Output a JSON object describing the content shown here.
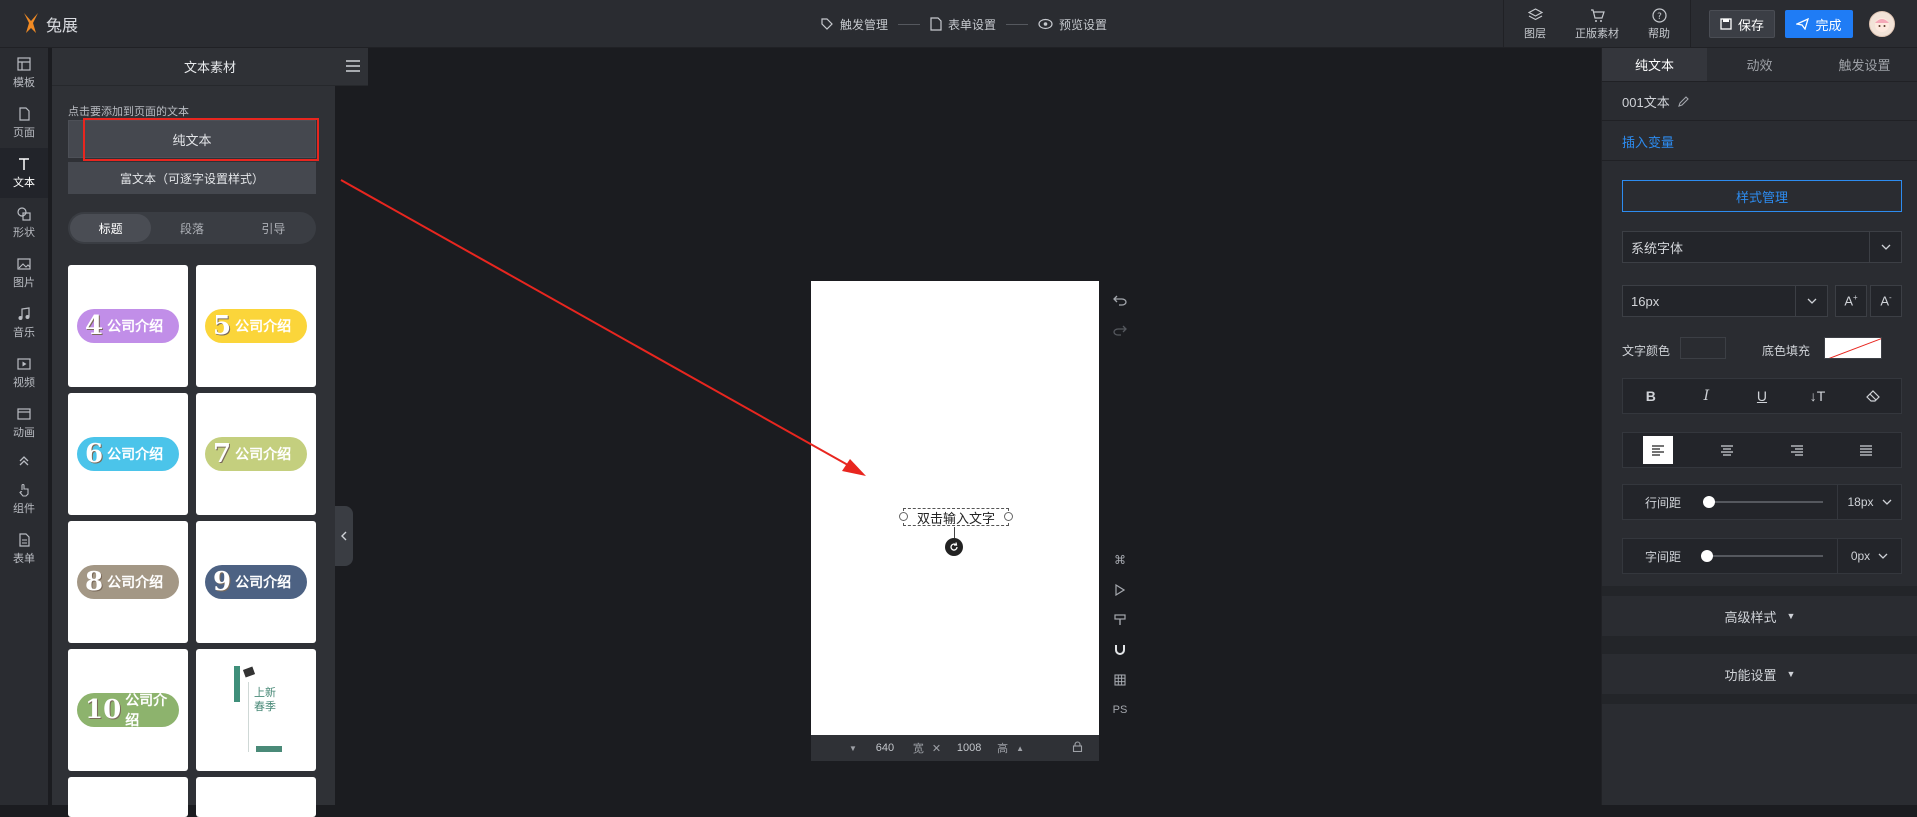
{
  "app": {
    "logo_text": "兔展"
  },
  "steps": [
    {
      "label": "触发管理"
    },
    {
      "label": "表单设置"
    },
    {
      "label": "预览设置"
    }
  ],
  "top_actions": {
    "layers": "图层",
    "assets": "正版素材",
    "help": "帮助",
    "save": "保存",
    "done": "完成"
  },
  "left_nav": [
    {
      "label": "模板"
    },
    {
      "label": "页面"
    },
    {
      "label": "文本"
    },
    {
      "label": "形状"
    },
    {
      "label": "图片"
    },
    {
      "label": "音乐"
    },
    {
      "label": "视频"
    },
    {
      "label": "动画"
    },
    {
      "label": "组件"
    },
    {
      "label": "表单"
    }
  ],
  "material": {
    "title": "文本素材",
    "hint": "点击要添加到页面的文本",
    "plain_btn": "纯文本",
    "rich_btn": "富文本（可逐字设置样式）",
    "subtabs": [
      "标题",
      "段落",
      "引导"
    ],
    "cards": [
      {
        "num": "4",
        "text": "公司介绍",
        "color": "#c18ee8"
      },
      {
        "num": "5",
        "text": "公司介绍",
        "color": "#fbd53a"
      },
      {
        "num": "6",
        "text": "公司介绍",
        "color": "#4bc4ea"
      },
      {
        "num": "7",
        "text": "公司介绍",
        "color": "#c4cf7e"
      },
      {
        "num": "8",
        "text": "公司介绍",
        "color": "#a39785"
      },
      {
        "num": "9",
        "text": "公司介绍",
        "color": "#4d6283"
      },
      {
        "num": "10",
        "text": "公司介绍",
        "color": "#8db36d"
      },
      {
        "num": "",
        "text": "上新春季",
        "color": "#ffffff"
      }
    ]
  },
  "canvas": {
    "placeholder_text": "双击输入文字",
    "width": "640",
    "width_unit": "宽",
    "height": "1008",
    "height_unit": "高",
    "side_tool_ps": "PS"
  },
  "right_panel": {
    "tabs": [
      "纯文本",
      "动效",
      "触发设置"
    ],
    "element_name": "001文本",
    "insert_var": "插入变量",
    "style_btn": "样式管理",
    "font_family": "系统字体",
    "font_size": "16px",
    "text_color_label": "文字颜色",
    "bg_fill_label": "底色填充",
    "line_height_label": "行间距",
    "line_height_value": "18px",
    "letter_spacing_label": "字间距",
    "letter_spacing_value": "0px",
    "advanced": "高级样式",
    "features": "功能设置",
    "accent": "#2d8cf0"
  }
}
